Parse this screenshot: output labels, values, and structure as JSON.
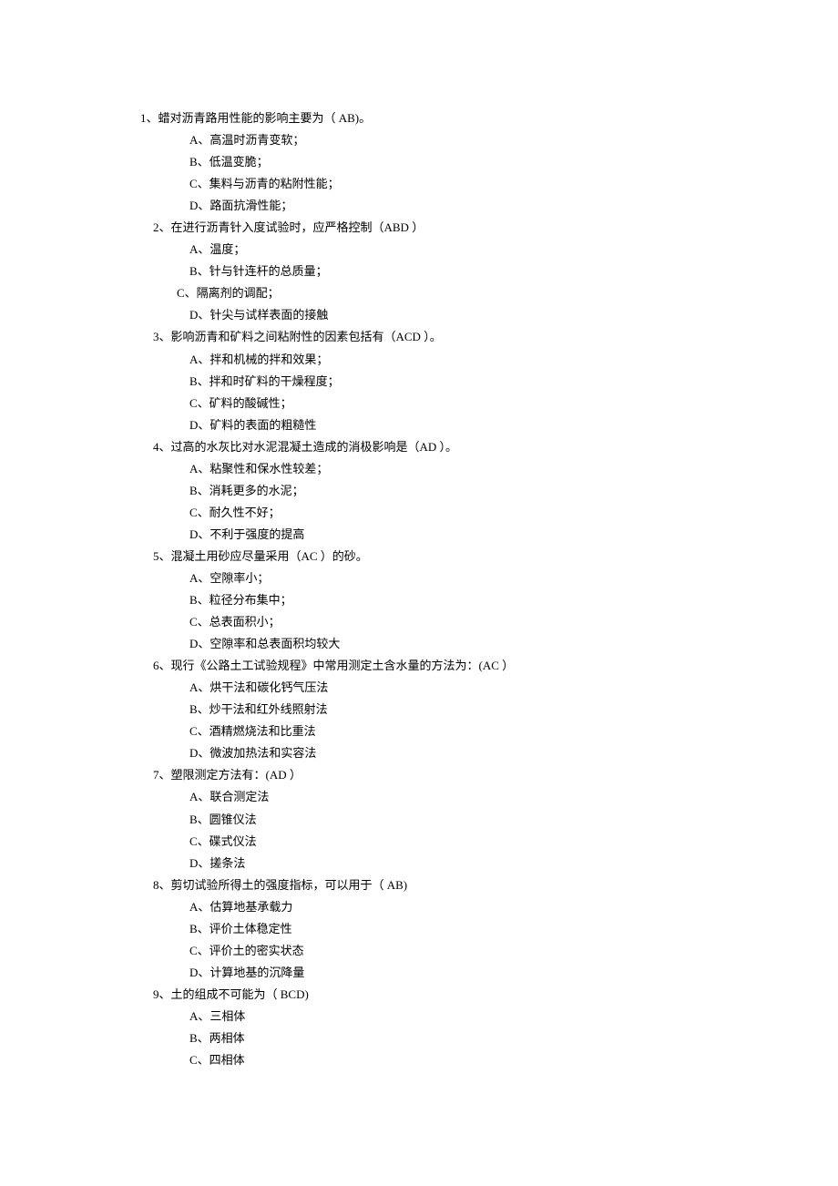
{
  "questions": [
    {
      "text": "1、蜡对沥青路用性能的影响主要为（ AB)。",
      "opts": [
        "A、高温时沥青变软；",
        "B、低温变脆；",
        "C、集料与沥青的粘附性能；",
        "D、路面抗滑性能；"
      ]
    },
    {
      "text": "2、在进行沥青针入度试验时，应严格控制（ABD   ）",
      "opts": [
        "A、温度；",
        "B、针与针连杆的总质量；",
        "C、隔离剂的调配；",
        "D、针尖与试样表面的接触"
      ],
      "cSpecial": true
    },
    {
      "text": "3、影响沥青和矿料之间粘附性的因素包括有（ACD ）。",
      "opts": [
        "A、拌和机械的拌和效果；",
        "B、拌和时矿料的干燥程度；",
        "C、矿料的酸碱性；",
        "D、矿料的表面的粗糙性"
      ]
    },
    {
      "text": "4、过高的水灰比对水泥混凝土造成的消极影响是（AD ）。",
      "opts": [
        "A、粘聚性和保水性较差；",
        "B、消耗更多的水泥；",
        "C、耐久性不好；",
        "D、不利于强度的提高"
      ]
    },
    {
      "text": "5、混凝土用砂应尽量采用（AC ）的砂。",
      "opts": [
        "A、空隙率小；",
        "B、粒径分布集中；",
        "C、总表面积小；",
        "D、空隙率和总表面积均较大"
      ]
    },
    {
      "text": "6、现行《公路土工试验规程》中常用测定土含水量的方法为：(AC ）",
      "opts": [
        "A、烘干法和碳化钙气压法",
        "B、炒干法和红外线照射法",
        "C、酒精燃烧法和比重法",
        "D、微波加热法和实容法"
      ]
    },
    {
      "text": "7、塑限测定方法有：(AD ）",
      "opts": [
        "A、联合测定法",
        "B、圆锥仪法",
        "C、碟式仪法",
        "D、搓条法"
      ]
    },
    {
      "text": "8、剪切试验所得土的强度指标，可以用于（ AB)",
      "opts": [
        "A、估算地基承载力",
        "B、评价土体稳定性",
        "C、评价土的密实状态",
        "D、计算地基的沉降量"
      ]
    },
    {
      "text": "9、土的组成不可能为（ BCD)",
      "opts": [
        "A、三相体",
        "B、两相体",
        "C、四相体"
      ]
    }
  ]
}
